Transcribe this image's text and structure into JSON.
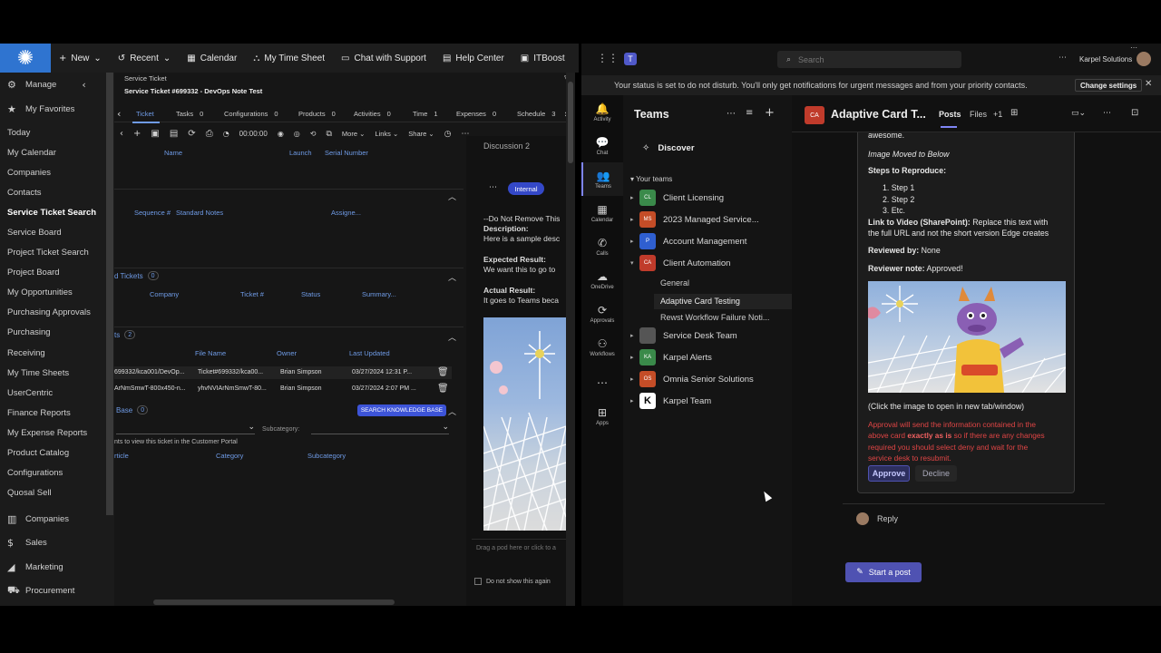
{
  "cw": {
    "top_nav": [
      {
        "icon": "plus-icon",
        "label": "New"
      },
      {
        "icon": "history-icon",
        "label": "Recent"
      },
      {
        "icon": "calendar-icon",
        "label": "Calendar"
      },
      {
        "icon": "timesheet-icon",
        "label": "My Time Sheet"
      },
      {
        "icon": "chat-icon",
        "label": "Chat with Support"
      },
      {
        "icon": "help-icon",
        "label": "Help Center"
      },
      {
        "icon": "itboost-icon",
        "label": "ITBoost"
      }
    ],
    "sidebar": {
      "manage": "Manage",
      "favorites": "My Favorites",
      "items": [
        "Today",
        "My Calendar",
        "Companies",
        "Contacts",
        "Service Ticket Search",
        "Service Board",
        "Project Ticket Search",
        "Project Board",
        "My Opportunities",
        "Purchasing Approvals",
        "Purchasing",
        "Receiving",
        "My Time Sheets",
        "UserCentric",
        "Finance Reports",
        "My Expense Reports",
        "Product Catalog",
        "Configurations",
        "Quosal Sell"
      ],
      "sections": [
        {
          "icon": "building-icon",
          "label": "Companies"
        },
        {
          "icon": "dollar-icon",
          "label": "Sales"
        },
        {
          "icon": "megaphone-icon",
          "label": "Marketing"
        },
        {
          "icon": "cart-icon",
          "label": "Procurement"
        }
      ]
    },
    "breadcrumb": "Service Ticket",
    "ticket_title": "Service Ticket #699332 - DevOps Note Test",
    "tabs": [
      {
        "label": "Ticket",
        "count": ""
      },
      {
        "label": "Tasks",
        "count": "0"
      },
      {
        "label": "Configurations",
        "count": "0"
      },
      {
        "label": "Products",
        "count": "0"
      },
      {
        "label": "Activities",
        "count": "0"
      },
      {
        "label": "Time",
        "count": "1"
      },
      {
        "label": "Expenses",
        "count": "0"
      },
      {
        "label": "Schedule",
        "count": "3"
      }
    ],
    "toolbar": {
      "timer": "00:00:00",
      "more": "More",
      "links": "Links",
      "share": "Share"
    },
    "config_headers": {
      "name": "Name",
      "launch": "Launch",
      "serial": "Serial Number"
    },
    "notes_headers": {
      "seq": "Sequence #",
      "standard": "Standard Notes",
      "assignee": "Assigne..."
    },
    "related": {
      "title": "d Tickets",
      "count": "0",
      "headers": [
        "Company",
        "Ticket #",
        "Status",
        "Summary..."
      ]
    },
    "docs": {
      "title": "ts",
      "count": "2",
      "headers": [
        "File Name",
        "Owner",
        "Last Updated"
      ],
      "rows": [
        {
          "a": "699332/kca001/DevOp...",
          "b": "Ticket#699332/kca00...",
          "owner": "Brian Simpson",
          "updated": "03/27/2024 12:31 P..."
        },
        {
          "a": "ArNmSmwT-800x450-n...",
          "b": "yhvNVIArNmSmwT-80...",
          "owner": "Brian Simpson",
          "updated": "03/27/2024 2:07 PM ..."
        }
      ]
    },
    "kb": {
      "title": "Base",
      "count": "0",
      "button": "SEARCH KNOWLEDGE BASE",
      "subcategory_label": "Subcategory:",
      "portal_note": "nts to view this ticket in the Customer Portal",
      "headers": [
        "rticle",
        "Category",
        "Subcategory"
      ]
    },
    "discussion": {
      "title": "Discussion",
      "count": "2",
      "badge": "Internal",
      "lines": [
        "--Do Not Remove This",
        "Description:",
        "Here is a sample desc",
        "Expected Result:",
        "We want this to go to",
        "Actual Result:",
        "It goes to Teams beca"
      ],
      "drop": "Drag a pod here or click to a",
      "dont_show": "Do not show this again"
    }
  },
  "teams": {
    "search_placeholder": "Search",
    "org": "Karpel Solutions",
    "notice": "Your status is set to do not disturb. You'll only get notifications for urgent messages and from your priority contacts.",
    "change_settings": "Change settings",
    "rail": [
      {
        "icon": "bell-icon",
        "label": "Activity"
      },
      {
        "icon": "chat-icon",
        "label": "Chat"
      },
      {
        "icon": "teams-icon",
        "label": "Teams"
      },
      {
        "icon": "calendar-icon",
        "label": "Calendar"
      },
      {
        "icon": "phone-icon",
        "label": "Calls"
      },
      {
        "icon": "cloud-icon",
        "label": "OneDrive"
      },
      {
        "icon": "approvals-icon",
        "label": "Approvals"
      },
      {
        "icon": "workflows-icon",
        "label": "Workflows"
      },
      {
        "icon": "more-icon",
        "label": ""
      },
      {
        "icon": "apps-icon",
        "label": "Apps"
      }
    ],
    "panel_title": "Teams",
    "discover": "Discover",
    "your_teams": "Your teams",
    "team_list": [
      {
        "abbr": "CL",
        "name": "Client Licensing",
        "color": "#3a8a4a"
      },
      {
        "abbr": "MS",
        "name": "2023 Managed Service...",
        "color": "#c44d27"
      },
      {
        "abbr": "P",
        "name": "Account Management",
        "color": "#2f5fd0"
      },
      {
        "abbr": "CA",
        "name": "Client Automation",
        "color": "#c03b2b"
      },
      {
        "abbr": "",
        "name": "Service Desk Team",
        "color": "#555555"
      },
      {
        "abbr": "KA",
        "name": "Karpel Alerts",
        "color": "#3a8a4a"
      },
      {
        "abbr": "OS",
        "name": "Omnia Senior Solutions",
        "color": "#c44d27"
      },
      {
        "abbr": "K",
        "name": "Karpel Team",
        "color": "#ffffff"
      }
    ],
    "channels": [
      "General",
      "Adaptive Card Testing",
      "Rewst Workflow Failure Noti..."
    ],
    "channel_avatar": "CA",
    "channel_title": "Adaptive Card T...",
    "posts": "Posts",
    "files": "Files",
    "plus_tabs": "+1",
    "card": {
      "awesome": "awesome.",
      "image_moved": "Image Moved to Below",
      "steps_title": "Steps to Reproduce:",
      "steps": [
        "1. Step 1",
        "2. Step 2",
        "3. Etc."
      ],
      "link_label": "Link to Video (SharePoint):",
      "link_text": " Replace this text with",
      "link_text2": "the full URL and not the short version Edge creates",
      "reviewed_label": "Reviewed by:",
      "reviewed_val": " None",
      "note_label": "Reviewer note:",
      "note_val": " Approved!",
      "click_hint": "(Click the image to open in new tab/window)",
      "warn1": "Approval will send the information contained in the",
      "warn2a": "above card ",
      "warn2b": "exactly as is",
      "warn2c": " so if there are any changes",
      "warn3": "required you should select deny and wait for the",
      "warn4": "service desk to resubmit.",
      "approve": "Approve",
      "decline": "Decline"
    },
    "reply": "Reply",
    "start_post": "Start a post"
  }
}
